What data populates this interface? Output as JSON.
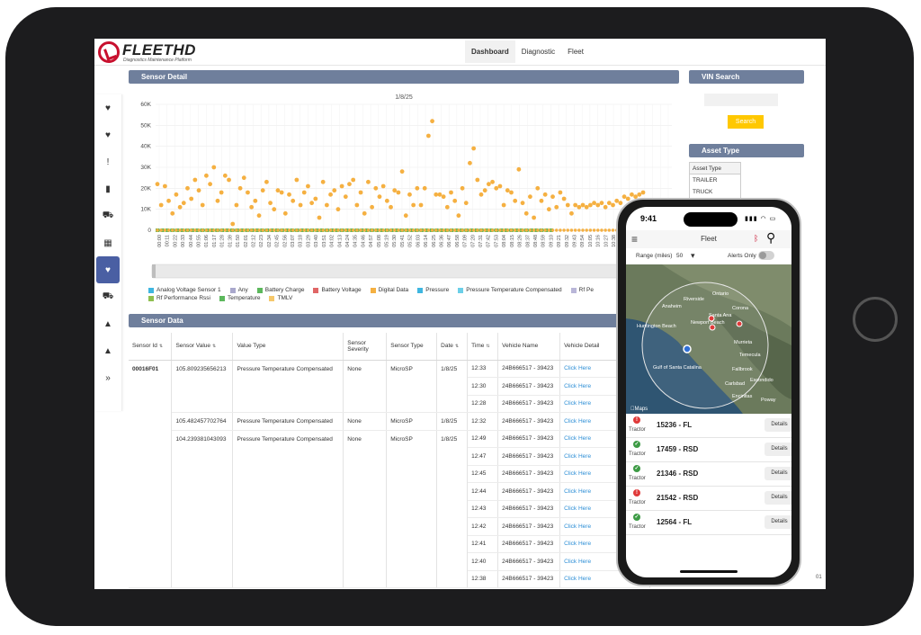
{
  "app": {
    "brand": "FLEETHD",
    "tagline": "Diagnostics Maintenance Platform",
    "tabs": [
      {
        "label": "Dashboard"
      },
      {
        "label": "Diagnostic"
      },
      {
        "label": "Fleet"
      }
    ],
    "active_tab": "Dashboard"
  },
  "sidebar": {
    "items": [
      {
        "icon": "heart-pulse-icon",
        "glyph": "♥"
      },
      {
        "icon": "heart-pulse-icon",
        "glyph": "♥"
      },
      {
        "icon": "alert-icon",
        "glyph": "!"
      },
      {
        "icon": "document-icon",
        "glyph": "▮"
      },
      {
        "icon": "truck-icon",
        "glyph": "⛟"
      },
      {
        "icon": "map-icon",
        "glyph": "▦"
      },
      {
        "icon": "sensor-heart-icon",
        "glyph": "♥"
      },
      {
        "icon": "truck-icon",
        "glyph": "⛟"
      },
      {
        "icon": "warning-icon",
        "glyph": "▲"
      },
      {
        "icon": "warning-icon",
        "glyph": "▲"
      },
      {
        "icon": "expand-icon",
        "glyph": "»"
      }
    ],
    "active_index": 6
  },
  "sensor_detail": {
    "title": "Sensor Detail"
  },
  "chart_data": {
    "type": "scatter",
    "title": "1/8/25",
    "ylim": [
      0,
      60000
    ],
    "yticks": [
      "0",
      "10K",
      "20K",
      "30K",
      "40K",
      "50K",
      "60K"
    ],
    "xticks": [
      "00:00",
      "00:11",
      "00:22",
      "00:33",
      "00:44",
      "00:55",
      "01:06",
      "01:17",
      "01:28",
      "01:39",
      "01:50",
      "02:01",
      "02:12",
      "02:23",
      "02:34",
      "02:45",
      "02:56",
      "03:07",
      "03:18",
      "03:29",
      "03:40",
      "03:51",
      "04:02",
      "04:13",
      "04:24",
      "04:35",
      "04:46",
      "04:57",
      "05:08",
      "05:19",
      "05:30",
      "05:41",
      "05:52",
      "06:03",
      "06:14",
      "06:25",
      "06:36",
      "06:47",
      "06:58",
      "07:09",
      "07:20",
      "07:31",
      "07:42",
      "07:53",
      "08:04",
      "08:15",
      "08:26",
      "08:37",
      "08:48",
      "08:59",
      "09:10",
      "09:21",
      "09:32",
      "09:43",
      "09:54",
      "10:05",
      "10:16",
      "10:27",
      "10:38",
      "10:49",
      "11:00",
      "11:11",
      "11:22",
      "11:33",
      "11:44",
      "11:55"
    ],
    "series": [
      {
        "name": "Digital Data",
        "color": "#f5b041",
        "values": [
          22000,
          12000,
          21000,
          14000,
          8000,
          17000,
          11000,
          13000,
          20000,
          15000,
          24000,
          19000,
          12000,
          26000,
          22000,
          30000,
          14000,
          18000,
          26000,
          24000,
          3000,
          12000,
          20000,
          25000,
          18000,
          11000,
          14000,
          7000,
          19000,
          23000,
          13000,
          10000,
          19000,
          18000,
          8000,
          17000,
          14000,
          24000,
          12000,
          18000,
          21000,
          13000,
          15000,
          6000,
          23000,
          12000,
          17000,
          19000,
          10000,
          21000,
          16000,
          22000,
          24000,
          12000,
          18000,
          8000,
          23000,
          11000,
          20000,
          16000,
          21000,
          14000,
          11000,
          19000,
          18000,
          28000,
          7000,
          17000,
          12000,
          20000,
          12000,
          20000,
          45000,
          52000,
          17000,
          17000,
          16000,
          11000,
          18000,
          14000,
          7000,
          20000,
          13000,
          32000,
          39000,
          24000,
          17000,
          19000,
          22000,
          23000,
          20000,
          21000,
          12000,
          19000,
          18000,
          14000,
          29000,
          13000,
          8000,
          16000,
          6000,
          20000,
          14000,
          17000,
          10000,
          16000,
          11000,
          18000,
          15000,
          12000,
          8000,
          12000,
          11000,
          12000,
          11000,
          12000,
          13000,
          12000,
          13000,
          11000,
          13000,
          12000,
          14000,
          13000,
          16000,
          15000,
          17000,
          16000,
          17000,
          18000
        ]
      },
      {
        "name": "Battery Charge",
        "color": "#5cb85c",
        "values": [
          0,
          0,
          0,
          0,
          0,
          0,
          0,
          0,
          0,
          0,
          0,
          0,
          0,
          0,
          0,
          0,
          0,
          0,
          0,
          0,
          0,
          0,
          0,
          0,
          0,
          0,
          0,
          0,
          0,
          0,
          0,
          0,
          0,
          0,
          0,
          0,
          0,
          0,
          0,
          0,
          0,
          0,
          0,
          0,
          0,
          0,
          0,
          0,
          0,
          0,
          0,
          0,
          0,
          0,
          0,
          0,
          0,
          0,
          0,
          0,
          0,
          0,
          0,
          0,
          0,
          0,
          0,
          0,
          0,
          0,
          0,
          0,
          0,
          0,
          0,
          0,
          0,
          0,
          0,
          0
        ]
      }
    ]
  },
  "legend": [
    {
      "label": "Analog Voltage Sensor 1",
      "color": "#3fb6e0"
    },
    {
      "label": "Any",
      "color": "#a9a8cc"
    },
    {
      "label": "Battery Charge",
      "color": "#5cb85c"
    },
    {
      "label": "Battery Voltage",
      "color": "#e06666"
    },
    {
      "label": "Digital Data",
      "color": "#f5b041"
    },
    {
      "label": "Pressure",
      "color": "#3fb6e0"
    },
    {
      "label": "Pressure Temperature Compensated",
      "color": "#6ccfe8"
    },
    {
      "label": "Rf Pe",
      "color": "#b9b6d8"
    },
    {
      "label": "Rf Performance Rssi",
      "color": "#8fbf4f"
    },
    {
      "label": "Temperature",
      "color": "#5cb85c"
    },
    {
      "label": "TMLV",
      "color": "#f6c86b"
    }
  ],
  "sensor_data": {
    "title": "Sensor Data",
    "columns": [
      "Sensor Id",
      "Sensor Value",
      "Value Type",
      "Sensor Severity",
      "Sensor Type",
      "Date",
      "Time",
      "Vehicle Name",
      "Vehicle Detail"
    ],
    "sensor_id": "00016F01",
    "groups": [
      {
        "value": "105.809235656213",
        "type": "Pressure Temperature Compensated",
        "severity": "None",
        "sensor_type": "MicroSP",
        "date": "1/8/25",
        "rows": [
          {
            "time": "12:33"
          },
          {
            "time": "12:30"
          },
          {
            "time": "12:28"
          }
        ]
      },
      {
        "value": "105.482457702764",
        "type": "Pressure Temperature Compensated",
        "severity": "None",
        "sensor_type": "MicroSP",
        "date": "1/8/25",
        "rows": [
          {
            "time": "12:32"
          }
        ]
      },
      {
        "value": "104.239381043093",
        "type": "Pressure Temperature Compensated",
        "severity": "None",
        "sensor_type": "MicroSP",
        "date": "1/8/25",
        "rows": [
          {
            "time": "12:49"
          },
          {
            "time": "12:47"
          },
          {
            "time": "12:45"
          },
          {
            "time": "12:44"
          },
          {
            "time": "12:43"
          },
          {
            "time": "12:42"
          },
          {
            "time": "12:41"
          },
          {
            "time": "12:40"
          },
          {
            "time": "12:38"
          }
        ]
      }
    ],
    "vehicle_name": "24B666517 - 39423",
    "link_label": "Click Here",
    "cut_text": "01"
  },
  "vin_search": {
    "title": "VIN Search",
    "button": "Search"
  },
  "asset_type": {
    "title": "Asset Type",
    "header": "Asset Type",
    "options": [
      "TRAILER",
      "TRUCK"
    ]
  },
  "phone": {
    "time": "9:41",
    "title": "Fleet",
    "range_label": "Range (miles)",
    "range_value": "50",
    "alerts_label": "Alerts Only",
    "map_credit": "Maps",
    "map_labels": [
      {
        "text": "Riverside"
      },
      {
        "text": "Santa Ana"
      },
      {
        "text": "Anaheim"
      },
      {
        "text": "Ontario"
      },
      {
        "text": "Corona"
      },
      {
        "text": "Murrieta"
      },
      {
        "text": "Carlsbad"
      },
      {
        "text": "Newport Beach"
      },
      {
        "text": "Huntington Beach"
      },
      {
        "text": "Fallbrook"
      },
      {
        "text": "Escondido"
      },
      {
        "text": "Encinitas"
      },
      {
        "text": "Poway"
      },
      {
        "text": "Gulf of Santa Catalina"
      },
      {
        "text": "Temecula"
      }
    ],
    "vehicles": [
      {
        "name": "15236 - FL",
        "type": "Tractor",
        "status": "alert",
        "color": "#e03a3a"
      },
      {
        "name": "17459 - RSD",
        "type": "Tractor",
        "status": "ok",
        "color": "#3d9b45"
      },
      {
        "name": "21346 - RSD",
        "type": "Tractor",
        "status": "ok",
        "color": "#3d9b45"
      },
      {
        "name": "21542 - RSD",
        "type": "Tractor",
        "status": "alert",
        "color": "#e03a3a"
      },
      {
        "name": "12564 - FL",
        "type": "Tractor",
        "status": "ok",
        "color": "#3d9b45"
      }
    ],
    "details_label": "Details"
  }
}
